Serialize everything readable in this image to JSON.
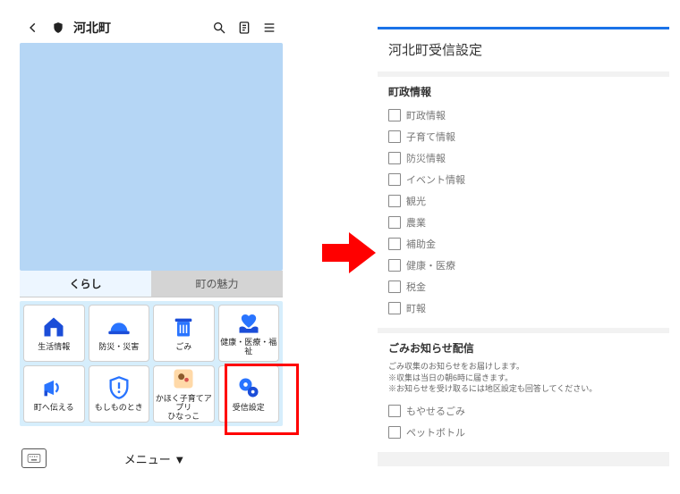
{
  "phone": {
    "title": "河北町",
    "tabs": {
      "active": "くらし",
      "inactive": "町の魅力"
    },
    "tiles": [
      {
        "id": "life",
        "label": "生活情報",
        "icon": "house"
      },
      {
        "id": "disaster",
        "label": "防災・災害",
        "icon": "helmet"
      },
      {
        "id": "garbage",
        "label": "ごみ",
        "icon": "trash"
      },
      {
        "id": "welfare",
        "label": "健康・医療・福祉",
        "icon": "heart-hands"
      },
      {
        "id": "voice",
        "label": "町へ伝える",
        "icon": "megaphone"
      },
      {
        "id": "emergency",
        "label": "もしものとき",
        "icon": "shield-alert"
      },
      {
        "id": "kosodate",
        "label": "かほく子育てアプリ\nひなっこ",
        "icon": "app-image"
      },
      {
        "id": "settings",
        "label": "受信設定",
        "icon": "gear-double"
      }
    ],
    "footer_menu": "メニュー ▼"
  },
  "settings": {
    "title": "河北町受信設定",
    "section1": {
      "title": "町政情報",
      "items": [
        "町政情報",
        "子育て情報",
        "防災情報",
        "イベント情報",
        "観光",
        "農業",
        "補助金",
        "健康・医療",
        "税金",
        "町報"
      ]
    },
    "section2": {
      "title": "ごみお知らせ配信",
      "sub": [
        "ごみ収集のお知らせをお届けします。",
        "※収集は当日の朝6時に届きます。",
        "※お知らせを受け取るには地区設定も回答してください。"
      ],
      "items": [
        "もやせるごみ",
        "ペットボトル"
      ]
    }
  }
}
